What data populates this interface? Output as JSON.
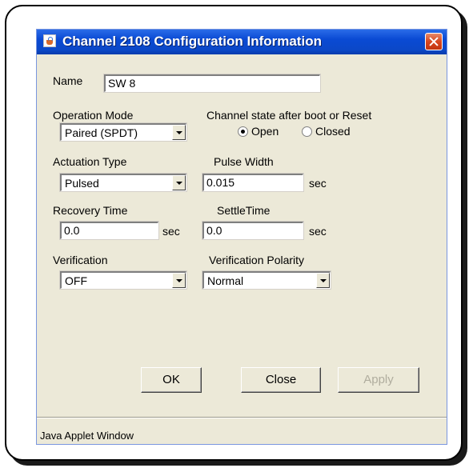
{
  "window": {
    "title": "Channel 2108 Configuration Information"
  },
  "form": {
    "name_label": "Name",
    "name_value": "SW 8",
    "operation_mode": {
      "label": "Operation Mode",
      "selected": "Paired (SPDT)"
    },
    "channel_state": {
      "label": "Channel state after boot or Reset",
      "options": [
        {
          "label": "Open",
          "checked": true
        },
        {
          "label": "Closed",
          "checked": false
        }
      ]
    },
    "actuation_type": {
      "label": "Actuation Type",
      "selected": "Pulsed"
    },
    "pulse_width": {
      "label": "Pulse Width",
      "value": "0.015",
      "unit": "sec"
    },
    "recovery_time": {
      "label": "Recovery Time",
      "value": "0.0",
      "unit": "sec"
    },
    "settle_time": {
      "label": "SettleTime",
      "value": "0.0",
      "unit": "sec"
    },
    "verification": {
      "label": "Verification",
      "selected": "OFF"
    },
    "verification_polarity": {
      "label": "Verification Polarity",
      "selected": "Normal"
    }
  },
  "buttons": {
    "ok": "OK",
    "close": "Close",
    "apply": "Apply"
  },
  "status": "Java Applet Window",
  "colors": {
    "titlebar": "#0a4ad4",
    "dialog_bg": "#ece9d8",
    "close_button": "#d8461f"
  }
}
